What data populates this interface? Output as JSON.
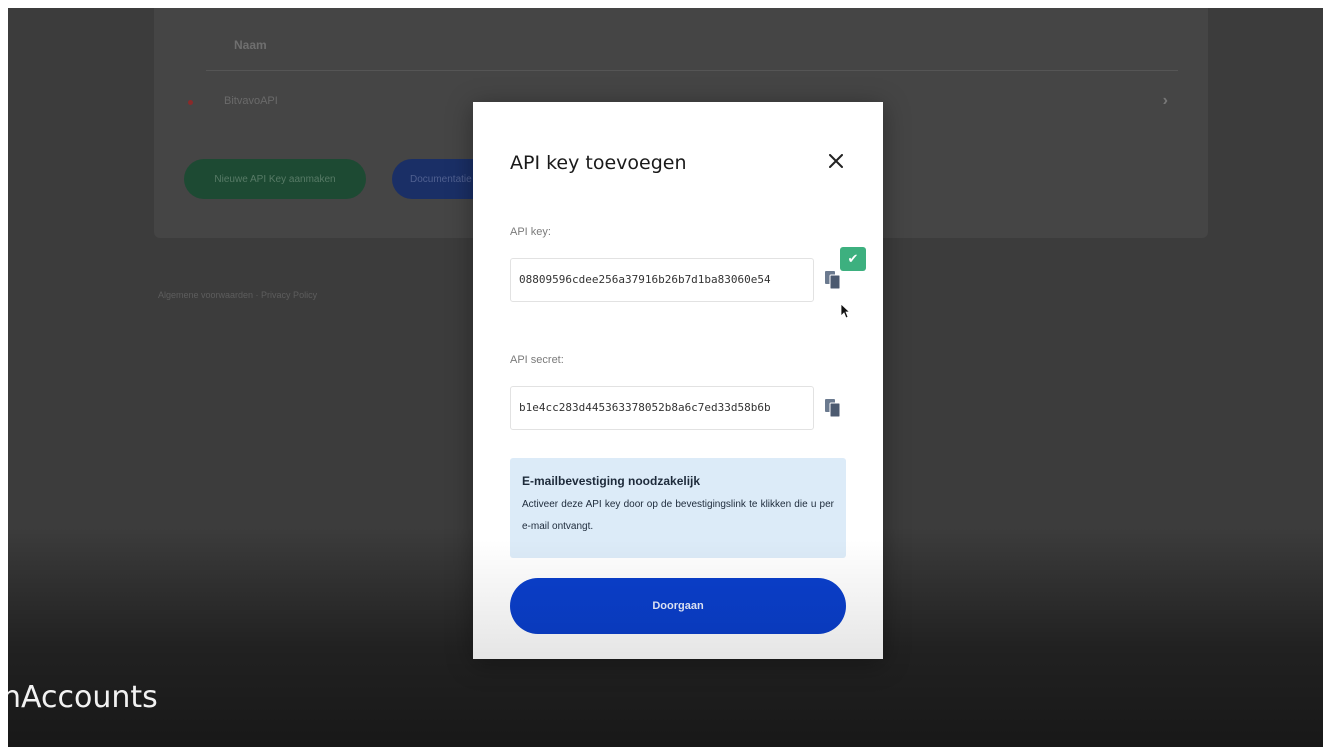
{
  "background": {
    "table_header": "Naam",
    "row_name": "BitvavoAPI",
    "row_chevron": "›",
    "new_key_button": "Nieuwe API Key aanmaken",
    "docs_button": "Documentatie",
    "footer_links": "Algemene voorwaarden  ·  Privacy Policy"
  },
  "modal": {
    "title": "API key toevoegen",
    "close_icon": "close-icon",
    "api_key_label": "API key:",
    "api_key_value": "08809596cdee256a37916b26b7d1ba83060e54",
    "api_secret_label": "API secret:",
    "api_secret_value": "b1e4cc283d445363378052b8a6c7ed33d58b6b",
    "copied_check": "✔",
    "info_title": "E-mailbevestiging noodzakelijk",
    "info_text": "Activeer deze API key door op de bevestigingslink te klikken die u per e-mail ontvangt.",
    "continue_button": "Doorgaan"
  },
  "caption": "nAccounts",
  "colors": {
    "primary_button": "#0a3fcc",
    "info_box": "#dcebf8",
    "copied_badge": "#3db07f"
  }
}
